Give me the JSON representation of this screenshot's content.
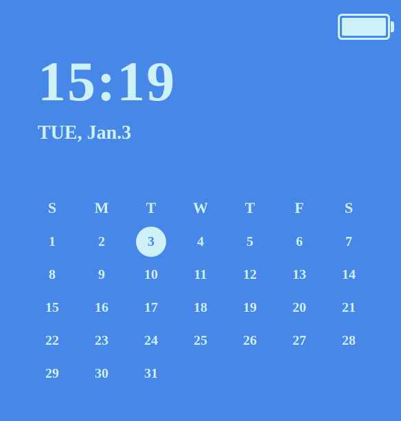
{
  "status": {
    "battery_level": 100
  },
  "clock": {
    "time": "15:19",
    "date": "TUE, Jan.3"
  },
  "calendar": {
    "day_headers": [
      "S",
      "M",
      "T",
      "W",
      "T",
      "F",
      "S"
    ],
    "today": 3,
    "days": [
      [
        1,
        2,
        3,
        4,
        5,
        6,
        7
      ],
      [
        8,
        9,
        10,
        11,
        12,
        13,
        14
      ],
      [
        15,
        16,
        17,
        18,
        19,
        20,
        21
      ],
      [
        22,
        23,
        24,
        25,
        26,
        27,
        28
      ],
      [
        29,
        30,
        31,
        null,
        null,
        null,
        null
      ]
    ]
  }
}
